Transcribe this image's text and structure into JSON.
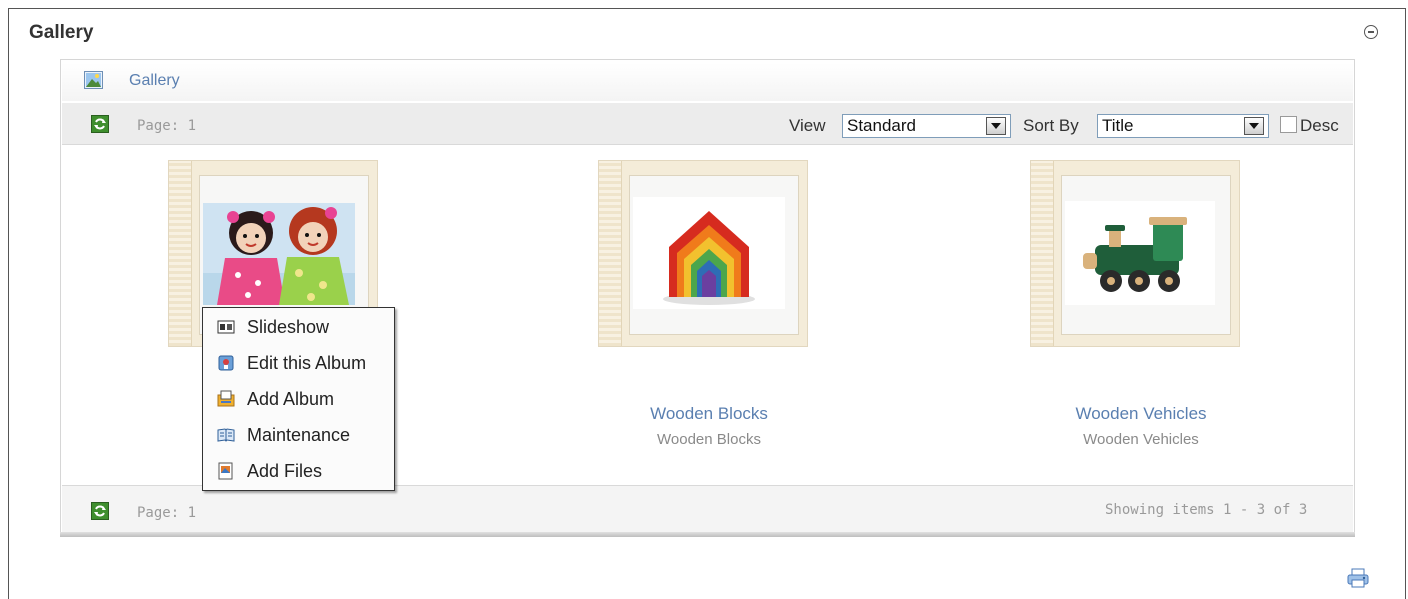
{
  "module": {
    "title": "Gallery"
  },
  "breadcrumb": {
    "label": "Gallery"
  },
  "toolbar": {
    "page_label": "Page: 1",
    "view_label": "View",
    "view_value": "Standard",
    "sort_label": "Sort By",
    "sort_value": "Title",
    "desc_label": "Desc"
  },
  "albums": [
    {
      "title": "",
      "description": ""
    },
    {
      "title": "Wooden Blocks",
      "description": "Wooden Blocks"
    },
    {
      "title": "Wooden Vehicles",
      "description": "Wooden Vehicles"
    }
  ],
  "context_menu": {
    "items": [
      {
        "label": "Slideshow",
        "icon": "slideshow-icon"
      },
      {
        "label": "Edit this Album",
        "icon": "edit-album-icon"
      },
      {
        "label": "Add Album",
        "icon": "add-album-icon"
      },
      {
        "label": "Maintenance",
        "icon": "maintenance-icon"
      },
      {
        "label": "Add Files",
        "icon": "add-files-icon"
      }
    ]
  },
  "footer": {
    "page_label": "Page: 1",
    "showing_text": "Showing items 1 - 3 of 3"
  },
  "colors": {
    "link": "#5a7fb0",
    "muted": "#9a9a9a",
    "album_frame": "#f4ecd9"
  }
}
